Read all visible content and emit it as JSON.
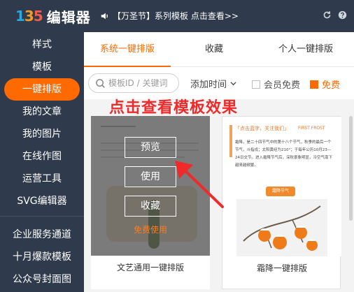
{
  "header": {
    "logo_mark": [
      "1",
      "3",
      "5"
    ],
    "logo_text": "编辑器",
    "notice": "【万圣节】系列模板 点击查看>>",
    "icons": [
      "speaker-icon",
      "refresh-icon",
      "help-icon"
    ]
  },
  "sidebar": {
    "items": [
      {
        "label": "样式"
      },
      {
        "label": "模板"
      },
      {
        "label": "一键排版",
        "active": true
      },
      {
        "label": "我的文章"
      },
      {
        "label": "我的图片"
      },
      {
        "label": "在线作图"
      },
      {
        "label": "运营工具"
      },
      {
        "label": "SVG编辑器"
      },
      {
        "label": "企业服务通道"
      },
      {
        "label": "十月爆款模板"
      },
      {
        "label": "公众号封面图"
      }
    ]
  },
  "tabs": [
    {
      "label": "系统一键排版",
      "active": true
    },
    {
      "label": "收藏"
    },
    {
      "label": "个人一键排版"
    }
  ],
  "filters": {
    "search_placeholder": "模板ID / 关键词",
    "sort_label": "添加时间",
    "member_free_label": "会员免费",
    "free_label": "免费"
  },
  "annotation": {
    "headline": "点击查看模板效果"
  },
  "cards": [
    {
      "title": "文艺通用一键排版",
      "overlay": {
        "preview": "预览",
        "use": "使用",
        "favorite": "收藏",
        "price_tag": "免费使用"
      }
    },
    {
      "title": "霜降一键排版",
      "thumb": {
        "banner": "「点击蓝字，关注我们」",
        "heading": "FIRST FROST",
        "text": "霜降，是二十四节气中的第十八个节气，秋季的最后一个节气，斗指戌；太阳黄经为210°；于每年公历10月23—24日交节。进入霜降节气后，深秋景象明显，冷空气南下越来越频繁。",
        "tag": "霜降节气"
      }
    }
  ],
  "colors": {
    "accent": "#ff6a00",
    "sidebar_bg": "#2f3b4c",
    "annotation_red": "#ef2a2a"
  }
}
